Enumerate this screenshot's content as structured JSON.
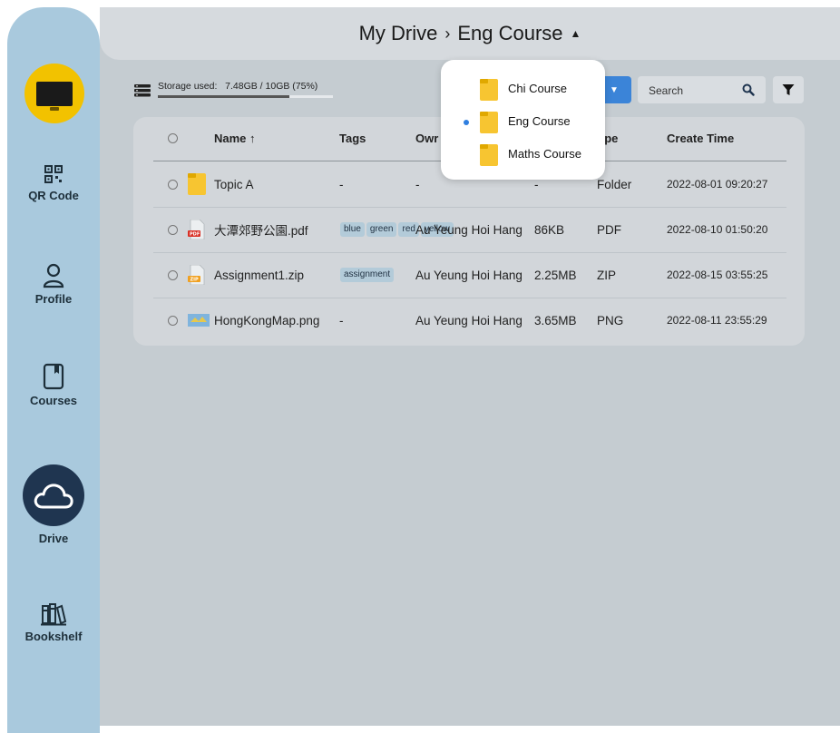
{
  "sidebar": {
    "items": [
      {
        "label": "QR Code",
        "icon": "qr-code-icon"
      },
      {
        "label": "Profile",
        "icon": "person-icon"
      },
      {
        "label": "Courses",
        "icon": "book-icon"
      },
      {
        "label": "Drive",
        "icon": "cloud-icon",
        "active": true
      },
      {
        "label": "Bookshelf",
        "icon": "bookshelf-icon"
      }
    ]
  },
  "breadcrumb": {
    "root": "My Drive",
    "separator": "›",
    "current": "Eng Course",
    "caret": "▲"
  },
  "storage": {
    "label": "Storage used:",
    "value": "7.48GB / 10GB (75%)",
    "fraction": 0.75
  },
  "search": {
    "placeholder": "Search"
  },
  "table": {
    "headers": {
      "name": "Name ↑",
      "tags": "Tags",
      "owner": "Owr",
      "size": "",
      "type": "ype",
      "create_time": "Create Time"
    },
    "rows": [
      {
        "name": "Topic A",
        "icon": "folder-icon",
        "tags": [],
        "tags_text": "-",
        "owner": "-",
        "size": "-",
        "type": "Folder",
        "create_time": "2022-08-01 09:20:27"
      },
      {
        "name": "大潭郊野公園.pdf",
        "icon": "pdf-icon",
        "tags": [
          "blue",
          "green",
          "red",
          "yellow"
        ],
        "tags_text": "",
        "owner": "Au Yeung Hoi Hang",
        "size": "86KB",
        "type": "PDF",
        "create_time": "2022-08-10 01:50:20"
      },
      {
        "name": "Assignment1.zip",
        "icon": "zip-icon",
        "tags": [
          "assignment"
        ],
        "tags_text": "",
        "owner": "Au Yeung Hoi Hang",
        "size": "2.25MB",
        "type": "ZIP",
        "create_time": "2022-08-15 03:55:25"
      },
      {
        "name": "HongKongMap.png",
        "icon": "image-icon",
        "tags": [],
        "tags_text": "-",
        "owner": "Au Yeung Hoi Hang",
        "size": "3.65MB",
        "type": "PNG",
        "create_time": "2022-08-11 23:55:29"
      }
    ]
  },
  "course_dropdown": {
    "items": [
      {
        "label": "Chi Course",
        "selected": false
      },
      {
        "label": "Eng Course",
        "selected": true
      },
      {
        "label": "Maths Course",
        "selected": false
      }
    ]
  },
  "colors": {
    "sidebar": "#a9c9dd",
    "drive_active": "#1f3550",
    "logo": "#f2c200",
    "folder": "#f7c531",
    "accent": "#3b84d8"
  }
}
